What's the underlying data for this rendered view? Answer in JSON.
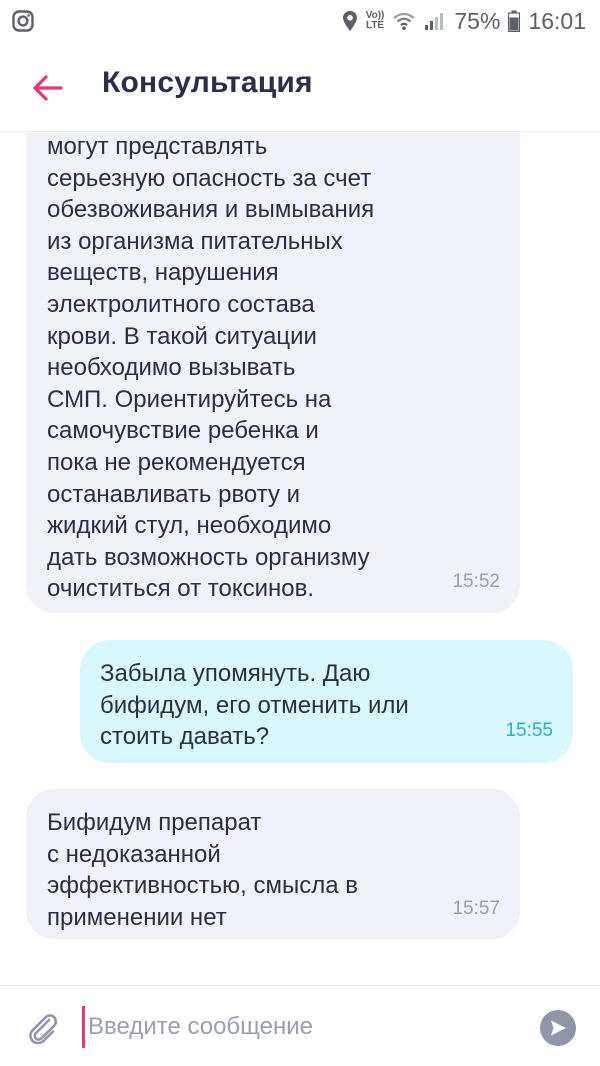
{
  "status_bar": {
    "left_icon": "instagram-icon",
    "battery_percent": "75%",
    "time": "16:01",
    "network": "LTE",
    "network_prefix": "Vo))",
    "icons": [
      "location-icon",
      "volte-icon",
      "wifi-icon",
      "signal-icon",
      "battery-icon"
    ]
  },
  "header": {
    "title": "Консультация",
    "back_icon": "arrow-left-icon",
    "accent_color": "#e8357a"
  },
  "messages": [
    {
      "direction": "incoming",
      "text": "могут представлять\nсерьезную опасность за счет\nобезвоживания и вымывания\nиз организма питательных\nвеществ, нарушения\nэлектролитного состава\nкрови. В такой ситуации\nнеобходимо вызывать\nСМП. Ориентируйтесь на\nсамочувствие ребенка и\nпока не рекомендуется\nостанавливать рвоту и\nжидкий стул, необходимо\nдать возможность организму\nочиститься от токсинов.",
      "time": "15:52"
    },
    {
      "direction": "outgoing",
      "text": "Забыла упомянуть. Даю\nбифидум, его отменить или\nстоить давать?",
      "time": "15:55"
    },
    {
      "direction": "incoming",
      "text": "Бифидум препарат\nс недоказанной\nэффективностью, смысла в\nприменении нет",
      "time": "15:57"
    }
  ],
  "composer": {
    "placeholder": "Введите сообщение",
    "attach_icon": "paperclip-icon",
    "send_icon": "send-icon"
  },
  "colors": {
    "incoming_bubble": "#f0f2f7",
    "outgoing_bubble": "#d9f8fb",
    "outgoing_time": "#26b3c4",
    "text": "#2a2f45"
  }
}
